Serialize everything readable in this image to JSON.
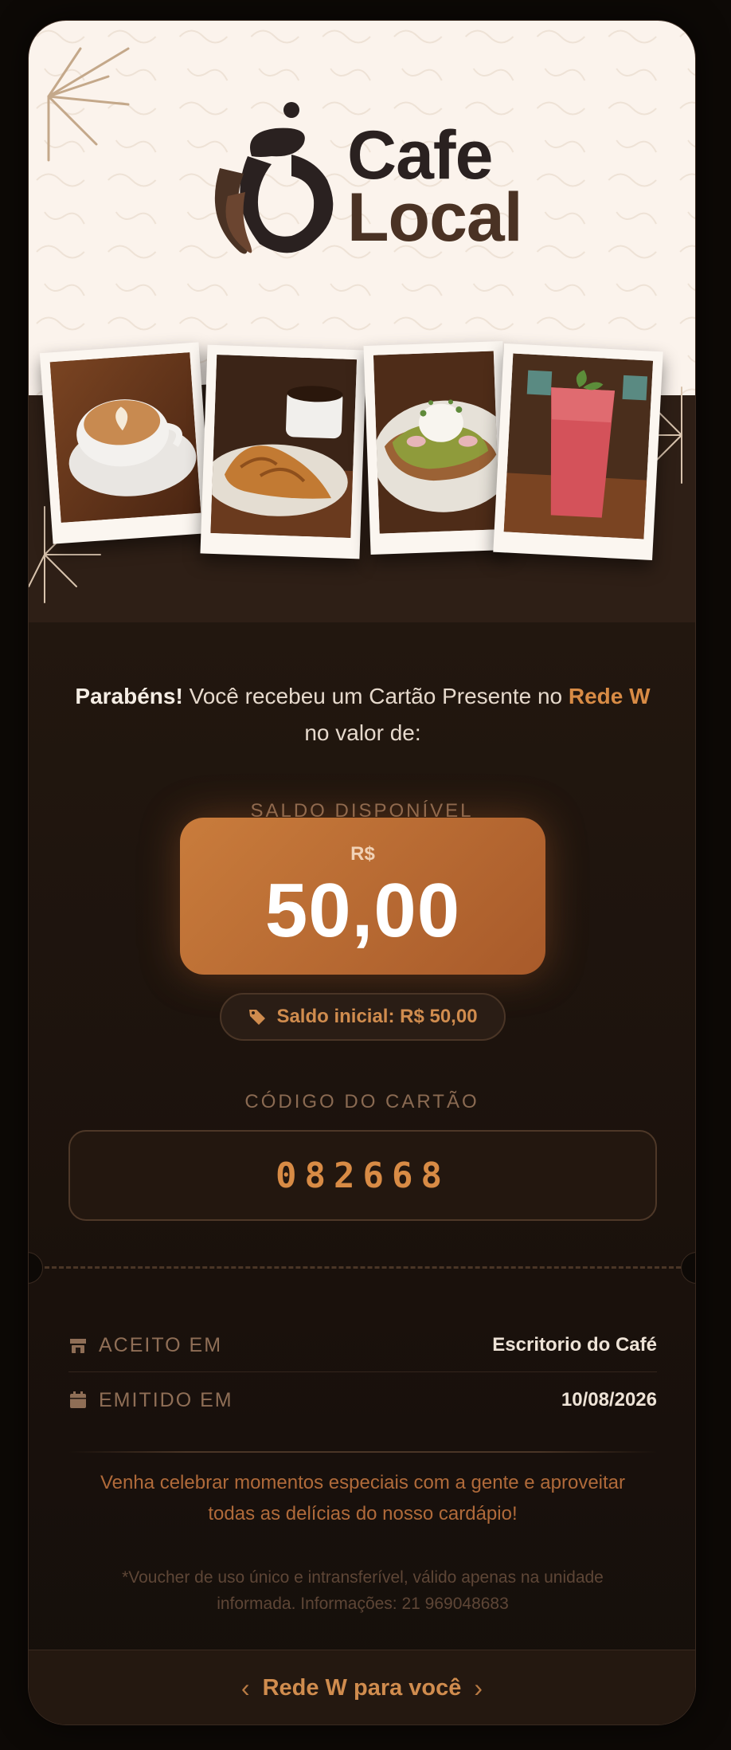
{
  "brand": {
    "name_line1": "Cafe",
    "name_line2": "Local",
    "logo_icon": "coffee-cup-logo-icon"
  },
  "photos": [
    {
      "name": "latte-photo",
      "subject": "latte art coffee cup"
    },
    {
      "name": "croissant-photo",
      "subject": "croissant and espresso"
    },
    {
      "name": "avocado-toast-photo",
      "subject": "avocado toast with poached egg"
    },
    {
      "name": "smoothie-photo",
      "subject": "berry smoothie"
    }
  ],
  "intro": {
    "congrats": "Parabéns!",
    "text_before": " Você recebeu um Cartão Presente no ",
    "network": "Rede W",
    "text_after": " no valor de:"
  },
  "balance": {
    "label": "SALDO DISPONÍVEL",
    "currency": "R$",
    "value": "50,00",
    "initial_label": "Saldo inicial: R$ 50,00",
    "tag_icon": "tag-icon"
  },
  "card_code": {
    "label": "CÓDIGO DO CARTÃO",
    "value": "082668"
  },
  "details": {
    "accepted_label": "ACEITO EM",
    "accepted_value": "Escritorio do Café",
    "accepted_icon": "store-icon",
    "issued_label": "EMITIDO EM",
    "issued_value": "10/08/2026",
    "issued_icon": "calendar-icon"
  },
  "promo_text": "Venha celebrar momentos especiais com a gente e aproveitar todas as delícias do nosso cardápio!",
  "fine_print": "*Voucher de uso único e intransferível, válido apenas na unidade informada. Informações: 21 969048683",
  "footer": {
    "text": "Rede W para você",
    "left_chevron": "‹",
    "right_chevron": "›"
  },
  "colors": {
    "accent": "#d88b45",
    "background": "#1f1510",
    "balance_gradient_start": "#c97c3c",
    "balance_gradient_end": "#a85a2a"
  }
}
